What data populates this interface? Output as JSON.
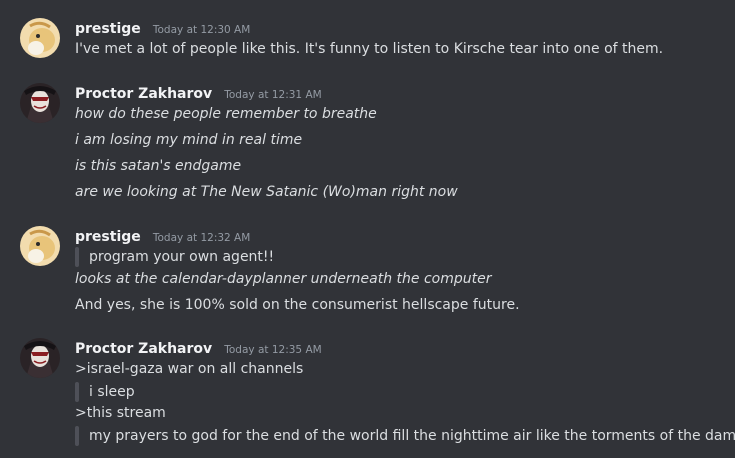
{
  "messages": [
    {
      "author": "prestige",
      "timestamp": "Today at 12:30 AM",
      "lines": [
        "I've met a lot of people like this.  It's funny to listen to Kirsche tear into one of them."
      ]
    },
    {
      "author": "Proctor Zakharov",
      "timestamp": "Today at 12:31 AM",
      "lines": [
        "how do these people remember to breathe",
        "i am losing my mind in real time",
        "is this satan's endgame",
        "are we looking at The New Satanic (Wo)man right now"
      ]
    },
    {
      "author": "prestige",
      "timestamp": "Today at 12:32 AM",
      "lines": [
        "program your own agent!!",
        "looks at the calendar-dayplanner underneath the computer",
        "And yes, she is 100% sold on the consumerist hellscape future."
      ]
    },
    {
      "author": "Proctor Zakharov",
      "timestamp": "Today at 12:35 AM",
      "lines": [
        ">israel-gaza war on all channels",
        "i sleep",
        ">this stream",
        "my prayers to god for the end of the world fill the nighttime air like the torments of the damn"
      ]
    }
  ],
  "colors": {
    "background": "#313338",
    "author": "#f2f3f5",
    "timestamp": "#949ba4",
    "text": "#dbdee1",
    "quote_bar": "#4e5058"
  },
  "icons": {
    "prestige_avatar": "cartoon-dog-avatar-icon",
    "proctor_avatar": "masked-figure-avatar-icon"
  }
}
